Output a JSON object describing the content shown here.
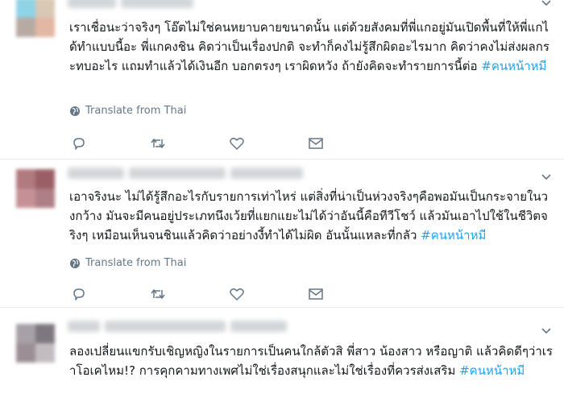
{
  "colors": {
    "text": "#14171a",
    "hashtag": "#1da1f2",
    "muted": "#657786",
    "divider": "#e6ecf0"
  },
  "tweets": [
    {
      "text": "เราเชื่อนะว่าจริงๆ โอ๊ตไม่ใช่คนหยาบคายขนาดนั้น แต่ด้วยสังคมที่พี่แกอยู่มันเปิดพื้นที่ให้พี่แกได้ทำแบบนี้อะ พี่แกคงชิน คิดว่าเป็นเรื่องปกติ จะทำก็คงไม่รู้สึกผิดอะไรมาก คิดว่าคงไม่ส่งผลกระทบอะไร แถมทำแล้วได้เงินอีก บอกตรงๆ เราผิดหวัง ถ้ายังคิดจะทำรายการนี้ต่อ",
      "hashtag": "#คนหน้าหมี",
      "translate_label": "Translate from Thai",
      "actions": [
        "reply-icon",
        "retweet-icon",
        "like-icon",
        "message-icon"
      ]
    },
    {
      "text": "เอาจริงนะ ไม่ได้รู้สึกอะไรกับรายการเท่าไหร่ แต่สิ่งที่น่าเป็นห่วงจริงๆคือพอมันเป็นกระจายในวงกว้าง มันจะมีคนอยู่ประเภทนึงเว้ยที่แยกแยะไม่ได้ว่าอันนี้คือทีวีโชว์ แล้วมันเอาไปใช้ในชีวิตจริงๆ เหมือนเห็นจนชินแล้วคิดว่าอย่างงี้ทำได้ไม่ผิด อันนั้นแหละที่กลัว",
      "hashtag": "#คนหน้าหมี",
      "translate_label": "Translate from Thai",
      "actions": [
        "reply-icon",
        "retweet-icon",
        "like-icon",
        "message-icon"
      ]
    },
    {
      "text": "ลองเปลี่ยนแขกรับเชิญหญิงในรายการเป็นคนใกล้ตัวสิ พี่สาว น้องสาว หรือญาติ แล้วคิดดีๆว่าเราโอเคไหม!? การคุกคามทางเพศไม่ใช่เรื่องสนุกและไม่ใช่เรื่องที่ควรส่งเสริม",
      "hashtag": "#คนหน้าหมี"
    }
  ]
}
